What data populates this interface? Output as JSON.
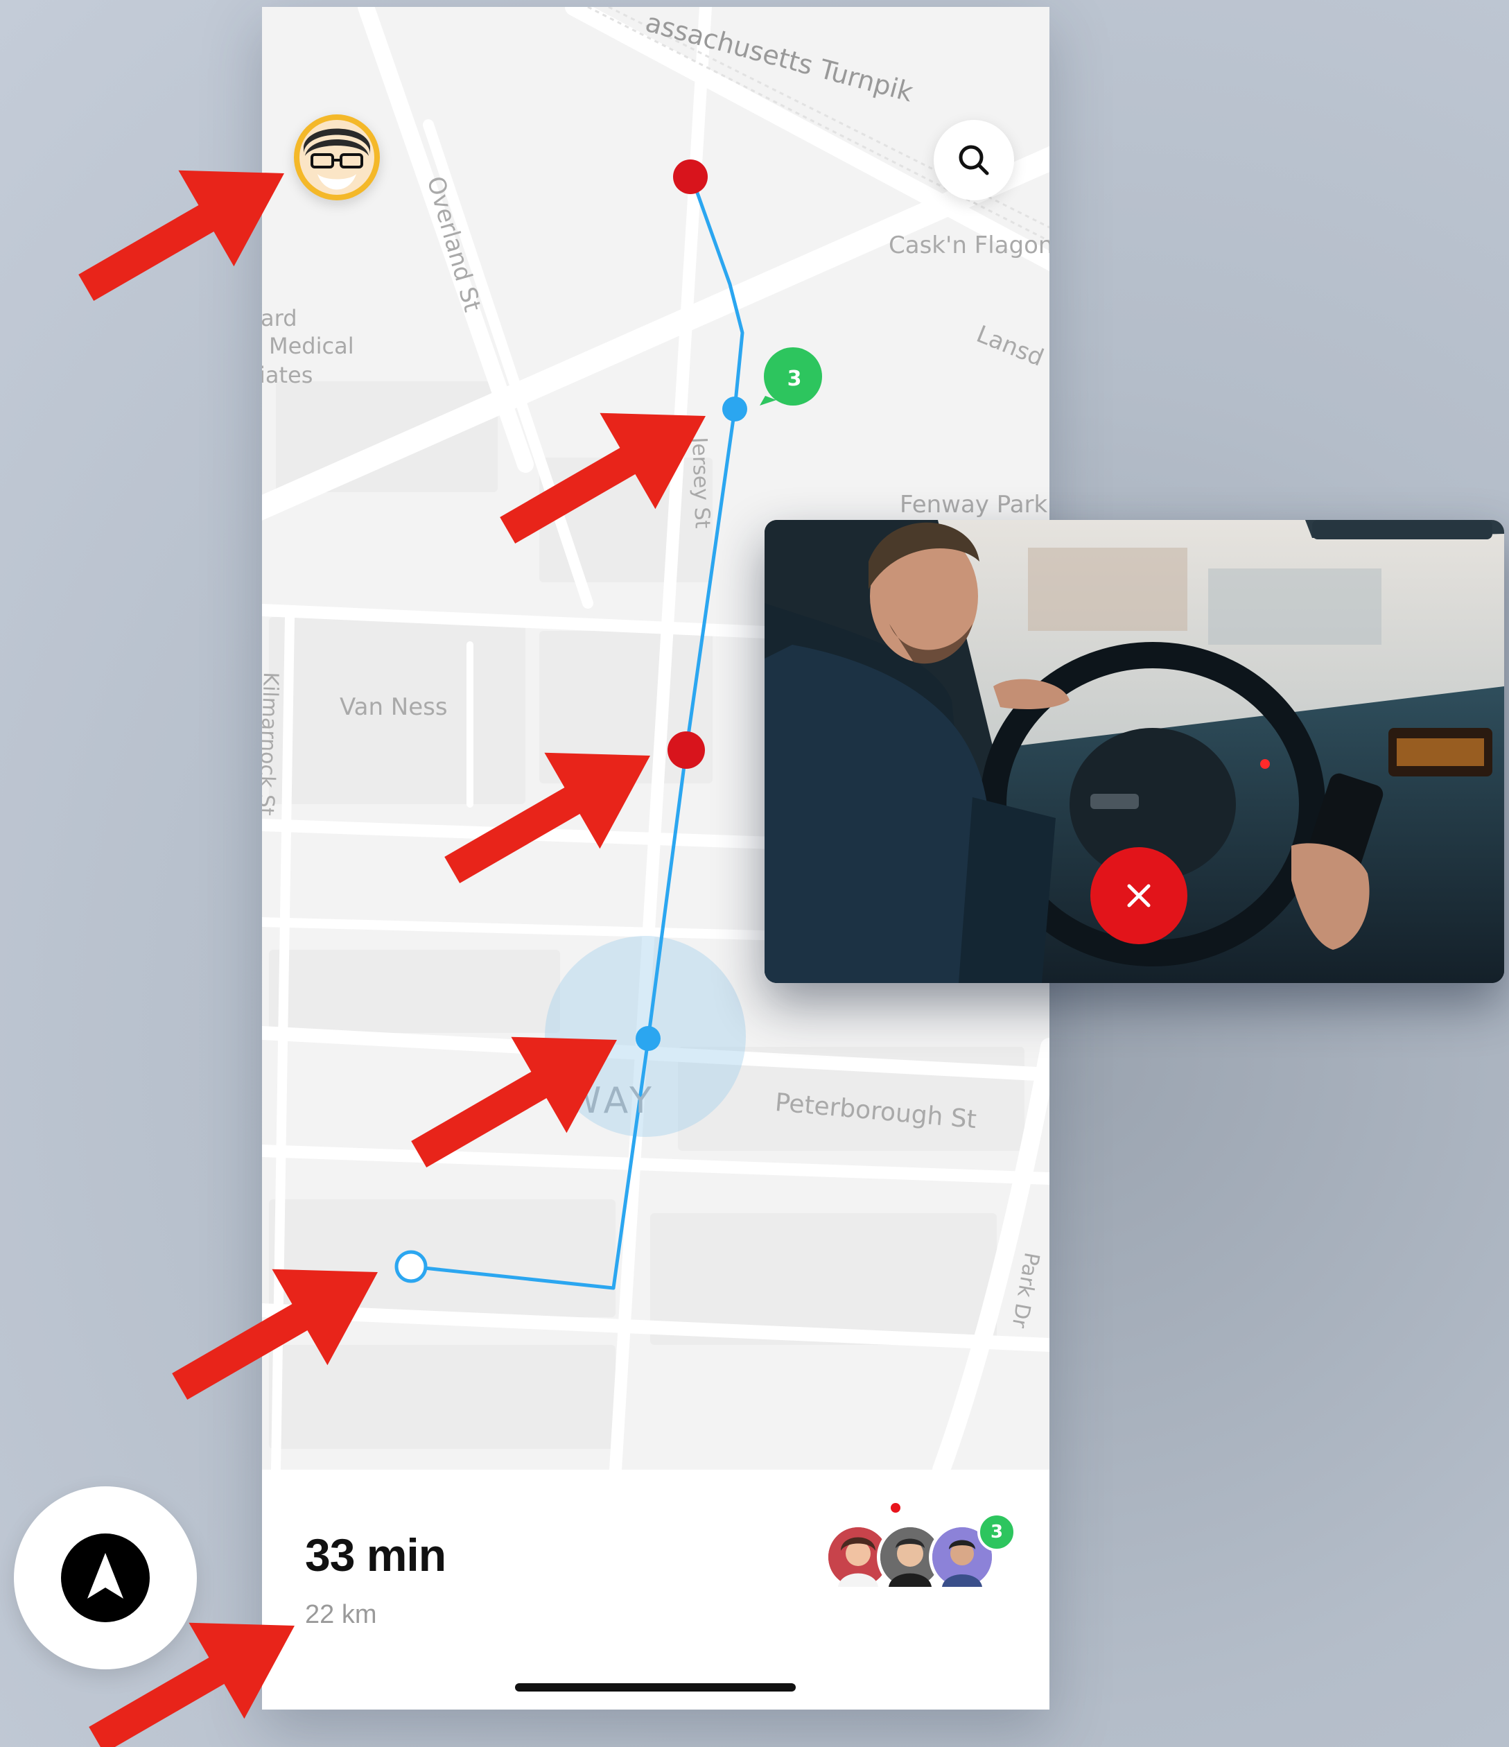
{
  "map": {
    "labels": [
      {
        "id": "turnpike",
        "text": "assachusetts Turnpik"
      },
      {
        "id": "cask",
        "text": "Cask'n Flagon"
      },
      {
        "id": "lansdowne",
        "text": "Lansd"
      },
      {
        "id": "overland",
        "text": "Overland St"
      },
      {
        "id": "medical_1",
        "text": "ard"
      },
      {
        "id": "medical_2",
        "text": "Medical"
      },
      {
        "id": "medical_3",
        "text": "iates"
      },
      {
        "id": "jersey",
        "text": "Jersey St"
      },
      {
        "id": "fenway",
        "text": "Fenway Park"
      },
      {
        "id": "vanness",
        "text": "Van Ness"
      },
      {
        "id": "kilmarnock",
        "text": "Kilmarnock St"
      },
      {
        "id": "way",
        "text": "WAY"
      },
      {
        "id": "peterborough",
        "text": "Peterborough St"
      },
      {
        "id": "parkdr",
        "text": "Park Dr"
      }
    ],
    "chat_badge_count": "3",
    "icons": [
      "user-avatar",
      "search-icon",
      "chat-bubble-icon",
      "route-stop-marker",
      "route-waypoint-marker",
      "route-start-marker",
      "location-halo"
    ]
  },
  "trip": {
    "eta": "33 min",
    "distance": "22 km",
    "riders_badge": "3"
  },
  "video": {
    "icons": [
      "close-icon"
    ],
    "end_call_color": "#e2141a"
  },
  "navigation": {
    "icon": "navigation-arrow-icon"
  },
  "colors": {
    "route": "#2ba6f0",
    "stop_marker": "#d8141c",
    "badge_green": "#2dc55e",
    "annotation_arrow": "#e8241a"
  }
}
